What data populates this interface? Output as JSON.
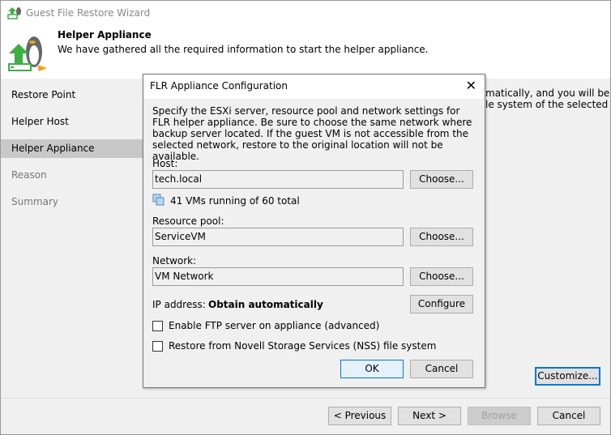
{
  "window": {
    "title": "Guest File Restore Wizard"
  },
  "header": {
    "title": "Helper Appliance",
    "subtitle": "We have gathered all the required information to start the helper appliance."
  },
  "sidebar": {
    "items": [
      {
        "label": "Restore Point"
      },
      {
        "label": "Helper Host"
      },
      {
        "label": "Helper Appliance",
        "selected": true
      },
      {
        "label": "Reason"
      },
      {
        "label": "Summary"
      }
    ]
  },
  "main": {
    "text_line1": "matically, and you will be",
    "text_line2": "le system of the selected",
    "customize_label": "Customize..."
  },
  "footer": {
    "previous": "< Previous",
    "next": "Next >",
    "browse": "Browse",
    "cancel": "Cancel"
  },
  "dialog": {
    "title": "FLR Appliance Configuration",
    "description": "Specify the ESXi server, resource pool and network settings for FLR helper appliance. Be sure to choose the same network where backup server located. If the guest VM is not accessible from the selected network, restore to the original location will not be available.",
    "host_label": "Host:",
    "host_value": "tech.local",
    "vm_status": "41 VMs running of 60 total",
    "pool_label": "Resource pool:",
    "pool_value": "ServiceVM",
    "network_label": "Network:",
    "network_value": "VM Network",
    "ip_label": "IP address:",
    "ip_value": "Obtain automatically",
    "choose": "Choose...",
    "configure": "Configure",
    "ftp_label": "Enable FTP server on appliance (advanced)",
    "ftp_checked": false,
    "nss_label": "Restore from Novell Storage Services (NSS) file system",
    "nss_checked": false,
    "ok": "OK",
    "cancel": "Cancel"
  }
}
